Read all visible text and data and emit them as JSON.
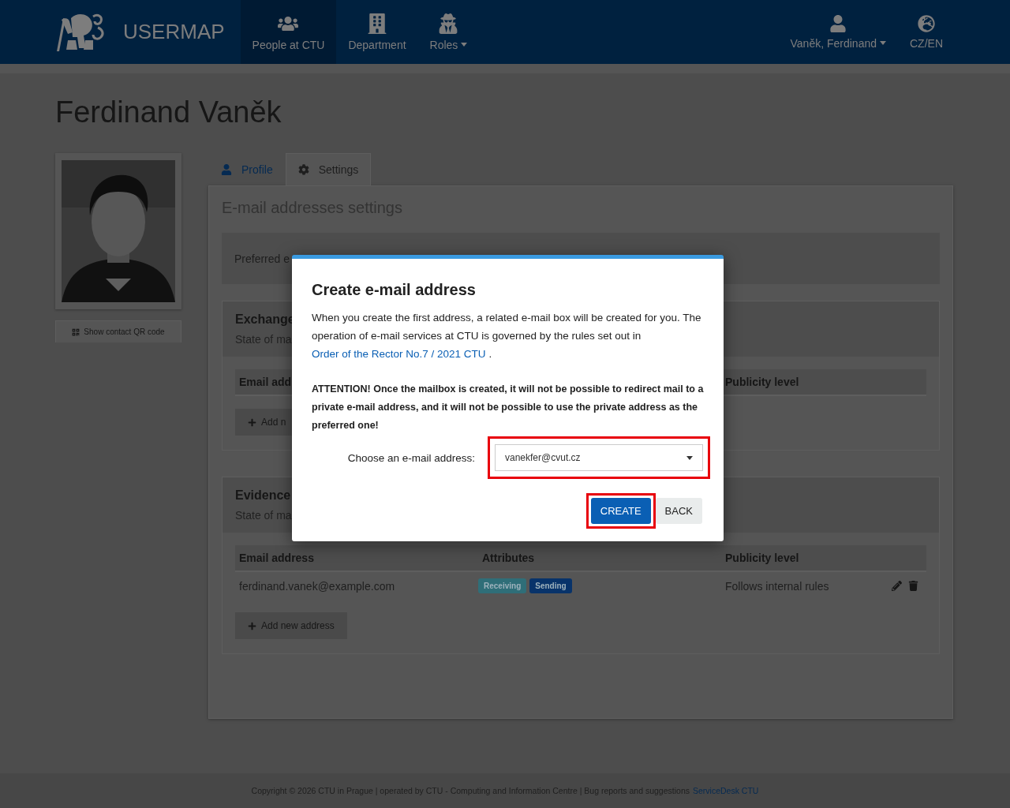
{
  "header": {
    "logo_text": "USERMAP",
    "nav": [
      {
        "label": "People at CTU",
        "selected": true,
        "dropdown": false
      },
      {
        "label": "Department",
        "selected": false,
        "dropdown": false
      },
      {
        "label": "Roles",
        "selected": false,
        "dropdown": true
      }
    ],
    "user": {
      "label": "Vaněk, Ferdinand",
      "selected": false,
      "dropdown": true
    },
    "language": {
      "label": "CZ/EN",
      "selected": false
    }
  },
  "page_title": "Ferdinand Vaněk",
  "sidebar": {
    "qr_button": "Show contact QR code"
  },
  "tabs": [
    {
      "label": "Profile",
      "selected": false
    },
    {
      "label": "Settings",
      "selected": true
    }
  ],
  "panel": {
    "title": "E-mail addresses settings",
    "preferred_label": "Preferred e",
    "sections": [
      {
        "title": "Exchange",
        "subtitle": "State of ma",
        "columns": [
          {
            "label": "Email add",
            "kind": "address"
          },
          {
            "label": "Publicity level",
            "kind": "publicity"
          }
        ],
        "add_button": "Add n"
      },
      {
        "title": "Evidence",
        "subtitle": "State of ma",
        "columns": [
          {
            "label": "Email address",
            "kind": "address"
          },
          {
            "label": "Attributes",
            "kind": "attributes"
          },
          {
            "label": "Publicity level",
            "kind": "publicity"
          }
        ],
        "rows": [
          {
            "address": "ferdinand.vanek@example.com",
            "tags": [
              {
                "label": "Receiving",
                "color": "#2f6e78"
              },
              {
                "label": "Sending",
                "color": "#08336a"
              }
            ],
            "publicity": "Follows internal rules"
          }
        ],
        "add_button": "Add new address"
      }
    ]
  },
  "modal": {
    "title": "Create e-mail address",
    "intro": "When you create the first address, a related e-mail box will be created for you. The operation of e-mail services at CTU is governed by the rules set out in",
    "link": "Order of the Rector No.7 / 2021 CTU",
    "intro_end": ".",
    "attention": "ATTENTION! Once the mailbox is created, it will not be possible to redirect mail to a private e-mail address, and it will not be possible to use the private address as the preferred one!",
    "field_label": "Choose an e-mail address:",
    "select_value": "vanekfer@cvut.cz",
    "select_highlighted": true,
    "buttons": [
      {
        "label": "CREATE",
        "kind": "primary",
        "highlighted": true
      },
      {
        "label": "BACK",
        "kind": "default",
        "highlighted": false
      }
    ]
  },
  "footer": {
    "text": "Copyright © 2026 CTU in Prague | operated by CTU - Computing and Information Centre | Bug reports and suggestions",
    "link": "ServiceDesk CTU"
  }
}
